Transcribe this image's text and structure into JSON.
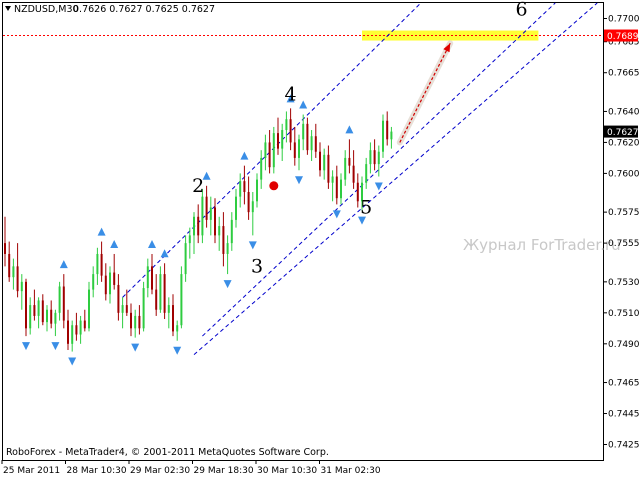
{
  "header": {
    "symbol": "NZDUSD,M30",
    "ohlc": "0.7626 0.7627 0.7625 0.7627"
  },
  "footer": {
    "copyright": "RoboForex - MetaTrader4, © 2001-2011 MetaQuotes Software Corp."
  },
  "watermark": "Журнал ForTrader.ru",
  "colors": {
    "bull": "#2ecc40",
    "bear": "#a00000",
    "channel": "#0000cc",
    "fractal": "#3a8ee6",
    "target_zone": "#ffff33",
    "target_line": "#ff0000",
    "price_badge": "#000000",
    "target_badge": "#ff0000"
  },
  "chart_data": {
    "type": "candlestick",
    "symbol": "NZDUSD",
    "timeframe": "M30",
    "ylim": [
      0.7415,
      0.771
    ],
    "yticks": [
      "0.7700",
      "0.7685",
      "0.7665",
      "0.7640",
      "0.7620",
      "0.7600",
      "0.7575",
      "0.7555",
      "0.7530",
      "0.7510",
      "0.7490",
      "0.7465",
      "0.7445",
      "0.7425"
    ],
    "xticks": [
      "25 Mar 2011",
      "28 Mar 10:30",
      "29 Mar 02:30",
      "29 Mar 18:30",
      "30 Mar 10:30",
      "31 Mar 02:30"
    ],
    "current_price": "0.7627",
    "target_price": "0.7689",
    "wave_labels": [
      {
        "label": "2",
        "bar": 46,
        "price": 0.7588
      },
      {
        "label": "3",
        "bar": 60,
        "price": 0.7536
      },
      {
        "label": "4",
        "bar": 68,
        "price": 0.7647
      },
      {
        "label": "5",
        "bar": 86,
        "price": 0.7574
      },
      {
        "label": "6",
        "bar": 123,
        "price": 0.7702
      }
    ],
    "channel_lines": [
      {
        "from": {
          "bar": 28,
          "price": 0.752
        },
        "to": {
          "bar": 99,
          "price": 0.771
        }
      },
      {
        "from": {
          "bar": 47,
          "price": 0.7495
        },
        "to": {
          "bar": 131,
          "price": 0.771
        }
      },
      {
        "from": {
          "bar": 45,
          "price": 0.7483
        },
        "to": {
          "bar": 141,
          "price": 0.771
        }
      }
    ],
    "target_arrow": {
      "from": {
        "bar": 94,
        "price": 0.762
      },
      "to": {
        "bar": 106,
        "price": 0.7684
      }
    },
    "target_zone": {
      "from_bar": 85,
      "to_bar": 127,
      "price": 0.7689
    },
    "marker": {
      "bar": 64,
      "price": 0.7592
    },
    "candles": [
      [
        0.7555,
        0.7572,
        0.754,
        0.7548
      ],
      [
        0.7548,
        0.7556,
        0.753,
        0.7533
      ],
      [
        0.7533,
        0.7545,
        0.7525,
        0.754
      ],
      [
        0.754,
        0.7555,
        0.752,
        0.7524
      ],
      [
        0.7524,
        0.7535,
        0.7512,
        0.753
      ],
      [
        0.753,
        0.7532,
        0.7495,
        0.75
      ],
      [
        0.75,
        0.752,
        0.7496,
        0.7515
      ],
      [
        0.7515,
        0.7525,
        0.7505,
        0.7508
      ],
      [
        0.7508,
        0.752,
        0.75,
        0.7518
      ],
      [
        0.7518,
        0.7522,
        0.7502,
        0.7504
      ],
      [
        0.7504,
        0.7515,
        0.7498,
        0.7512
      ],
      [
        0.7512,
        0.7518,
        0.75,
        0.7503
      ],
      [
        0.7503,
        0.7512,
        0.7495,
        0.751
      ],
      [
        0.751,
        0.753,
        0.7505,
        0.7527
      ],
      [
        0.7527,
        0.7535,
        0.75,
        0.7505
      ],
      [
        0.7505,
        0.7512,
        0.7486,
        0.749
      ],
      [
        0.749,
        0.7505,
        0.7485,
        0.7502
      ],
      [
        0.7502,
        0.751,
        0.7492,
        0.7496
      ],
      [
        0.7496,
        0.7508,
        0.749,
        0.7505
      ],
      [
        0.7505,
        0.7512,
        0.7498,
        0.75
      ],
      [
        0.75,
        0.753,
        0.7498,
        0.7525
      ],
      [
        0.7525,
        0.754,
        0.752,
        0.7535
      ],
      [
        0.7535,
        0.7552,
        0.7528,
        0.7548
      ],
      [
        0.7548,
        0.7556,
        0.753,
        0.7534
      ],
      [
        0.7534,
        0.7542,
        0.7518,
        0.7522
      ],
      [
        0.7522,
        0.754,
        0.7516,
        0.7536
      ],
      [
        0.7536,
        0.7548,
        0.7525,
        0.7528
      ],
      [
        0.7528,
        0.7535,
        0.7505,
        0.751
      ],
      [
        0.751,
        0.752,
        0.75,
        0.7515
      ],
      [
        0.7515,
        0.7525,
        0.7508,
        0.751
      ],
      [
        0.751,
        0.7516,
        0.7495,
        0.75
      ],
      [
        0.75,
        0.7512,
        0.7494,
        0.7508
      ],
      [
        0.7508,
        0.7515,
        0.7496,
        0.75
      ],
      [
        0.75,
        0.753,
        0.7498,
        0.7526
      ],
      [
        0.7526,
        0.7545,
        0.752,
        0.754
      ],
      [
        0.754,
        0.7548,
        0.7522,
        0.7525
      ],
      [
        0.7525,
        0.7535,
        0.7508,
        0.7512
      ],
      [
        0.7512,
        0.754,
        0.751,
        0.7535
      ],
      [
        0.7535,
        0.7542,
        0.7506,
        0.751
      ],
      [
        0.751,
        0.752,
        0.75,
        0.7515
      ],
      [
        0.7515,
        0.7522,
        0.7495,
        0.7498
      ],
      [
        0.7498,
        0.7505,
        0.7492,
        0.7502
      ],
      [
        0.7502,
        0.754,
        0.75,
        0.7535
      ],
      [
        0.7535,
        0.756,
        0.753,
        0.7555
      ],
      [
        0.7555,
        0.7565,
        0.7545,
        0.756
      ],
      [
        0.756,
        0.7575,
        0.7548,
        0.7572
      ],
      [
        0.7572,
        0.758,
        0.7555,
        0.756
      ],
      [
        0.756,
        0.759,
        0.7555,
        0.7585
      ],
      [
        0.7585,
        0.7592,
        0.7565,
        0.757
      ],
      [
        0.757,
        0.7585,
        0.756,
        0.7578
      ],
      [
        0.7578,
        0.7584,
        0.7555,
        0.756
      ],
      [
        0.756,
        0.7572,
        0.755,
        0.7566
      ],
      [
        0.7566,
        0.7575,
        0.754,
        0.7548
      ],
      [
        0.7548,
        0.756,
        0.7535,
        0.7555
      ],
      [
        0.7555,
        0.7575,
        0.755,
        0.757
      ],
      [
        0.757,
        0.759,
        0.7565,
        0.7585
      ],
      [
        0.7585,
        0.76,
        0.7578,
        0.7595
      ],
      [
        0.7595,
        0.7605,
        0.758,
        0.7588
      ],
      [
        0.7588,
        0.7598,
        0.757,
        0.7575
      ],
      [
        0.7575,
        0.7588,
        0.756,
        0.7582
      ],
      [
        0.7582,
        0.76,
        0.7578,
        0.7596
      ],
      [
        0.7596,
        0.7615,
        0.759,
        0.761
      ],
      [
        0.761,
        0.7625,
        0.7602,
        0.762
      ],
      [
        0.762,
        0.7628,
        0.76,
        0.7604
      ],
      [
        0.7604,
        0.763,
        0.76,
        0.7626
      ],
      [
        0.7626,
        0.7636,
        0.7612,
        0.7616
      ],
      [
        0.7616,
        0.7632,
        0.7608,
        0.7628
      ],
      [
        0.7628,
        0.764,
        0.762,
        0.7635
      ],
      [
        0.7635,
        0.7642,
        0.7615,
        0.762
      ],
      [
        0.762,
        0.763,
        0.7605,
        0.761
      ],
      [
        0.761,
        0.7625,
        0.7602,
        0.7622
      ],
      [
        0.7622,
        0.7638,
        0.7615,
        0.7632
      ],
      [
        0.7632,
        0.7636,
        0.7612,
        0.7615
      ],
      [
        0.7615,
        0.7628,
        0.7608,
        0.7624
      ],
      [
        0.7624,
        0.7632,
        0.761,
        0.7614
      ],
      [
        0.7614,
        0.762,
        0.7598,
        0.7602
      ],
      [
        0.7602,
        0.7616,
        0.7596,
        0.7612
      ],
      [
        0.7612,
        0.7618,
        0.759,
        0.7594
      ],
      [
        0.7594,
        0.7602,
        0.7582,
        0.7598
      ],
      [
        0.7598,
        0.7605,
        0.758,
        0.7584
      ],
      [
        0.7584,
        0.76,
        0.758,
        0.7596
      ],
      [
        0.7596,
        0.7615,
        0.7592,
        0.761
      ],
      [
        0.761,
        0.7622,
        0.76,
        0.7605
      ],
      [
        0.7605,
        0.7615,
        0.759,
        0.7594
      ],
      [
        0.7594,
        0.76,
        0.7578,
        0.7582
      ],
      [
        0.7582,
        0.7598,
        0.7576,
        0.7594
      ],
      [
        0.7594,
        0.761,
        0.759,
        0.7606
      ],
      [
        0.7606,
        0.762,
        0.76,
        0.7615
      ],
      [
        0.7615,
        0.7622,
        0.7602,
        0.7606
      ],
      [
        0.7606,
        0.7618,
        0.7598,
        0.7614
      ],
      [
        0.7614,
        0.7638,
        0.761,
        0.7634
      ],
      [
        0.7634,
        0.764,
        0.7618,
        0.7622
      ],
      [
        0.7622,
        0.763,
        0.7616,
        0.7627
      ]
    ]
  }
}
